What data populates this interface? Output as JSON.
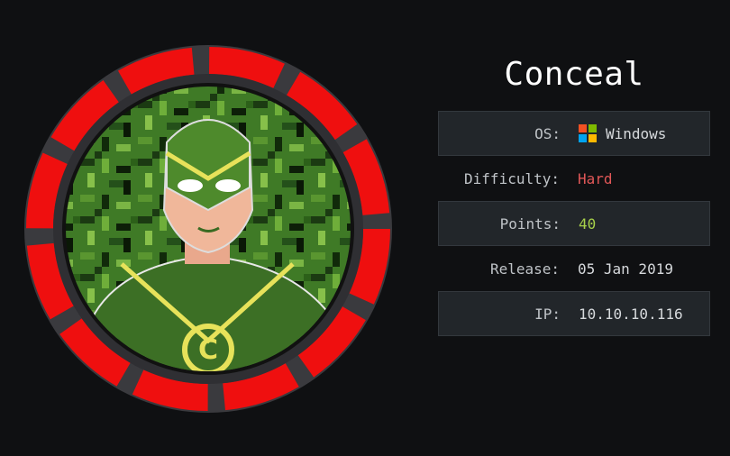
{
  "machine": {
    "name": "Conceal",
    "avatar_icon": "masked-hero-camo-avatar",
    "avatar_emblem_letter": "C",
    "accent_ring_color": "#ef0f0f"
  },
  "info": {
    "os_label": "OS:",
    "os_value": "Windows",
    "os_icon": "windows-logo-icon",
    "difficulty_label": "Difficulty:",
    "difficulty_value": "Hard",
    "difficulty_color": "#e05757",
    "points_label": "Points:",
    "points_value": "40",
    "points_color": "#a7d04a",
    "release_label": "Release:",
    "release_value": "05 Jan 2019",
    "ip_label": "IP:",
    "ip_value": "10.10.10.116"
  }
}
